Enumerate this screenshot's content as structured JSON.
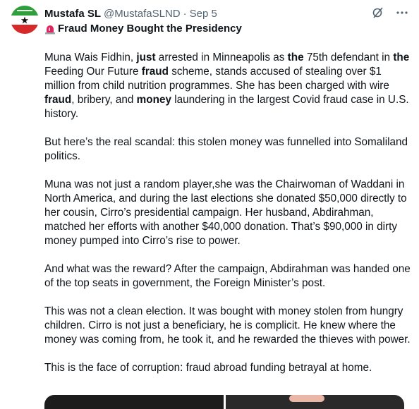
{
  "author": {
    "name": "Mustafa SL",
    "handle": "@MustafaSLND",
    "separator": "·",
    "date": "Sep 5"
  },
  "tweet": {
    "title": "Fraud Money Bought the Presidency",
    "paragraphs": [
      [
        {
          "t": "Muna Wais Fidhin, ",
          "b": false
        },
        {
          "t": "just",
          "b": true
        },
        {
          "t": " arrested in Minneapolis as ",
          "b": false
        },
        {
          "t": "the",
          "b": true
        },
        {
          "t": " 75th defendant in ",
          "b": false
        },
        {
          "t": "the",
          "b": true
        },
        {
          "t": " Feeding Our Future ",
          "b": false
        },
        {
          "t": "fraud",
          "b": true
        },
        {
          "t": " scheme, stands accused of stealing over $1 million from child nutrition programmes. She has been charged with wire ",
          "b": false
        },
        {
          "t": "fraud",
          "b": true
        },
        {
          "t": ", bribery, and ",
          "b": false
        },
        {
          "t": "money",
          "b": true
        },
        {
          "t": " laundering in the largest Covid fraud case in U.S. history.",
          "b": false
        }
      ],
      [
        {
          "t": "But here’s the real scandal: this stolen money was funnelled into Somaliland politics.",
          "b": false
        }
      ],
      [
        {
          "t": "Muna was not just a random player,she was the Chairwoman of Waddani in North America, and during the last elections she donated $50,000 directly to her cousin, Cirro’s presidential campaign. Her husband, Abdirahman, matched her efforts with another $40,000 donation. That’s $90,000 in dirty money pumped into Cirro’s rise to power.",
          "b": false
        }
      ],
      [
        {
          "t": "And what was the reward? After the campaign, Abdirahman was handed one of the top seats in government, the Foreign Minister’s post.",
          "b": false
        }
      ],
      [
        {
          "t": "This was not a clean election. It was bought with money stolen from hungry children. Cirro is not just a beneficiary, he is complicit. He knew where the money was coming from, he took it, and he rewarded the thieves with power.",
          "b": false
        }
      ],
      [
        {
          "t": "This is the face of corruption: fraud abroad funding betrayal at home.",
          "b": false
        }
      ]
    ]
  },
  "icons": {
    "title_emoji": "siren-icon",
    "grok": "grok-icon",
    "more": "more-icon"
  },
  "colors": {
    "text": "#0f1419",
    "secondary": "#536471",
    "flag_green": "#2f9e3b",
    "flag_red": "#d62a2a",
    "siren_red": "#e0245e"
  }
}
